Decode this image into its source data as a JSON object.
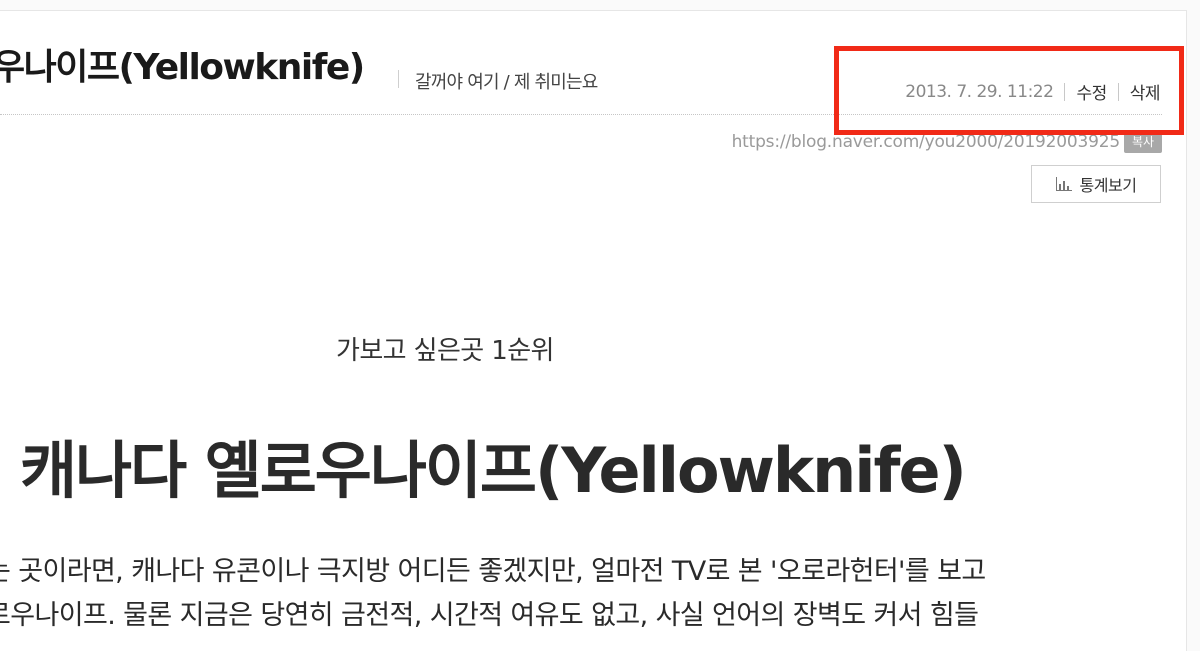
{
  "post": {
    "title": "우나이프(Yellowknife)",
    "category": "갈꺼야 여기 / 제 취미는요",
    "date": "2013. 7. 29. 11:22",
    "edit_label": "수정",
    "delete_label": "삭제",
    "url": "https://blog.naver.com/you2000/20192003925",
    "copy_label": "복사",
    "stats_label": "통계보기"
  },
  "content": {
    "subtitle": "가보고 싶은곳 1순위",
    "heading": "캐나다 옐로우나이프(Yellowknife)",
    "lines": [
      "는 곳이라면, 캐나다 유콘이나 극지방 어디든 좋겠지만, 얼마전 TV로 본 '오로라헌터'를 보고",
      "로우나이프. 물론 지금은 당연히 금전적, 시간적 여유도 없고, 사실 언어의 장벽도 커서 힘들"
    ]
  },
  "colors": {
    "highlight_border": "#f12a17",
    "date_text": "#888888",
    "copy_button_bg": "#a8a8a8"
  },
  "icons": {
    "stats": "bar-chart-icon"
  }
}
